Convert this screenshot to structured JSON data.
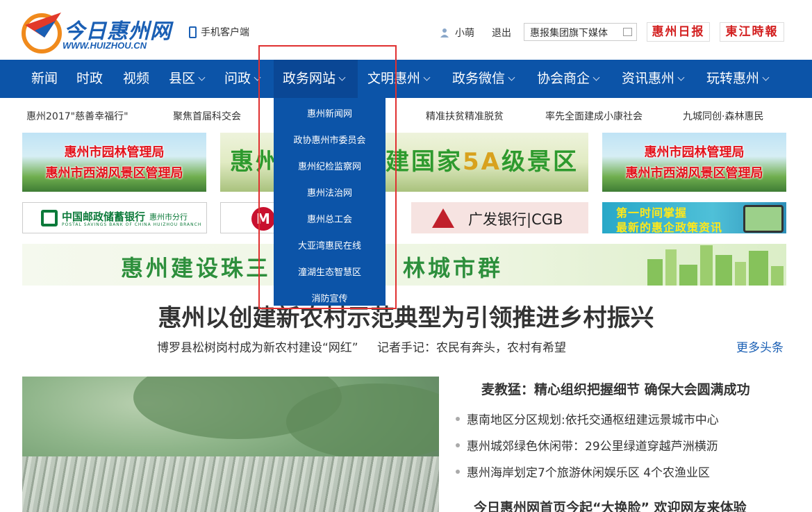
{
  "header": {
    "logo_text": "今日惠州网",
    "logo_url": "WWW.HUIZHOU.CN",
    "mobile_label": "手机客户端",
    "username": "小萌",
    "logout_label": "退出",
    "media_select_value": "惠报集团旗下媒体",
    "paper1": "惠州日报",
    "paper2": "東江時報"
  },
  "nav": {
    "items": [
      "新闻",
      "时政",
      "视频",
      "县区",
      "问政",
      "政务网站",
      "文明惠州",
      "政务微信",
      "协会商企",
      "资讯惠州",
      "玩转惠州"
    ],
    "active_index": 5
  },
  "dropdown": {
    "items": [
      "惠州新闻网",
      "政协惠州市委员会",
      "惠州纪检监察网",
      "惠州法治网",
      "惠州总工会",
      "大亚湾惠民在线",
      "潼湖生态智慧区",
      "消防宣传"
    ]
  },
  "topics": [
    "惠州2017\"慈善幸福行\"",
    "聚焦首届科交会",
    "精准扶贫精准脱贫",
    "率先全面建成小康社会",
    "九城同创·森林惠民"
  ],
  "banners": {
    "park_line1": "惠州市园林管理局",
    "park_line2": "惠州市西湖风景区管理局",
    "scenic_part1": "惠州",
    "scenic_part2": "建国家",
    "scenic_part3": "5A",
    "scenic_part4": "级景区",
    "postal_cn": "中国邮政储蓄银行",
    "postal_branch": "惠州市分行",
    "postal_en": "POSTAL SAVINGS BANK OF CHINA  HUIZHOU BRANCH",
    "cgb_text": "广发银行|CGB",
    "policy_line1": "第一时间掌握",
    "policy_line2": "最新的惠企政策资讯",
    "green_part1": "惠州建设珠三",
    "green_part2": "林城市群"
  },
  "headline": {
    "title": "惠州以创建新农村示范典型为引领推进乡村振兴",
    "sub1": "博罗县松树岗村成为新农村建设“网红”",
    "sub2": "记者手记：农民有奔头，农村有希望",
    "more": "更多头条"
  },
  "news": {
    "title": "麦教猛：精心组织把握细节 确保大会圆满成功",
    "items": [
      "惠南地区分区规划:依托交通枢纽建远景城市中心",
      "惠州城郊绿色休闲带：29公里绿道穿越芦洲横沥",
      "惠州海岸划定7个旅游休闲娱乐区 4个农渔业区"
    ],
    "title2": "今日惠州网首页今起“大换脸” 欢迎网友来体验"
  },
  "colors": {
    "nav_bg": "#0c54a8",
    "accent_red": "#e03030",
    "link_blue": "#1a5fb4"
  }
}
